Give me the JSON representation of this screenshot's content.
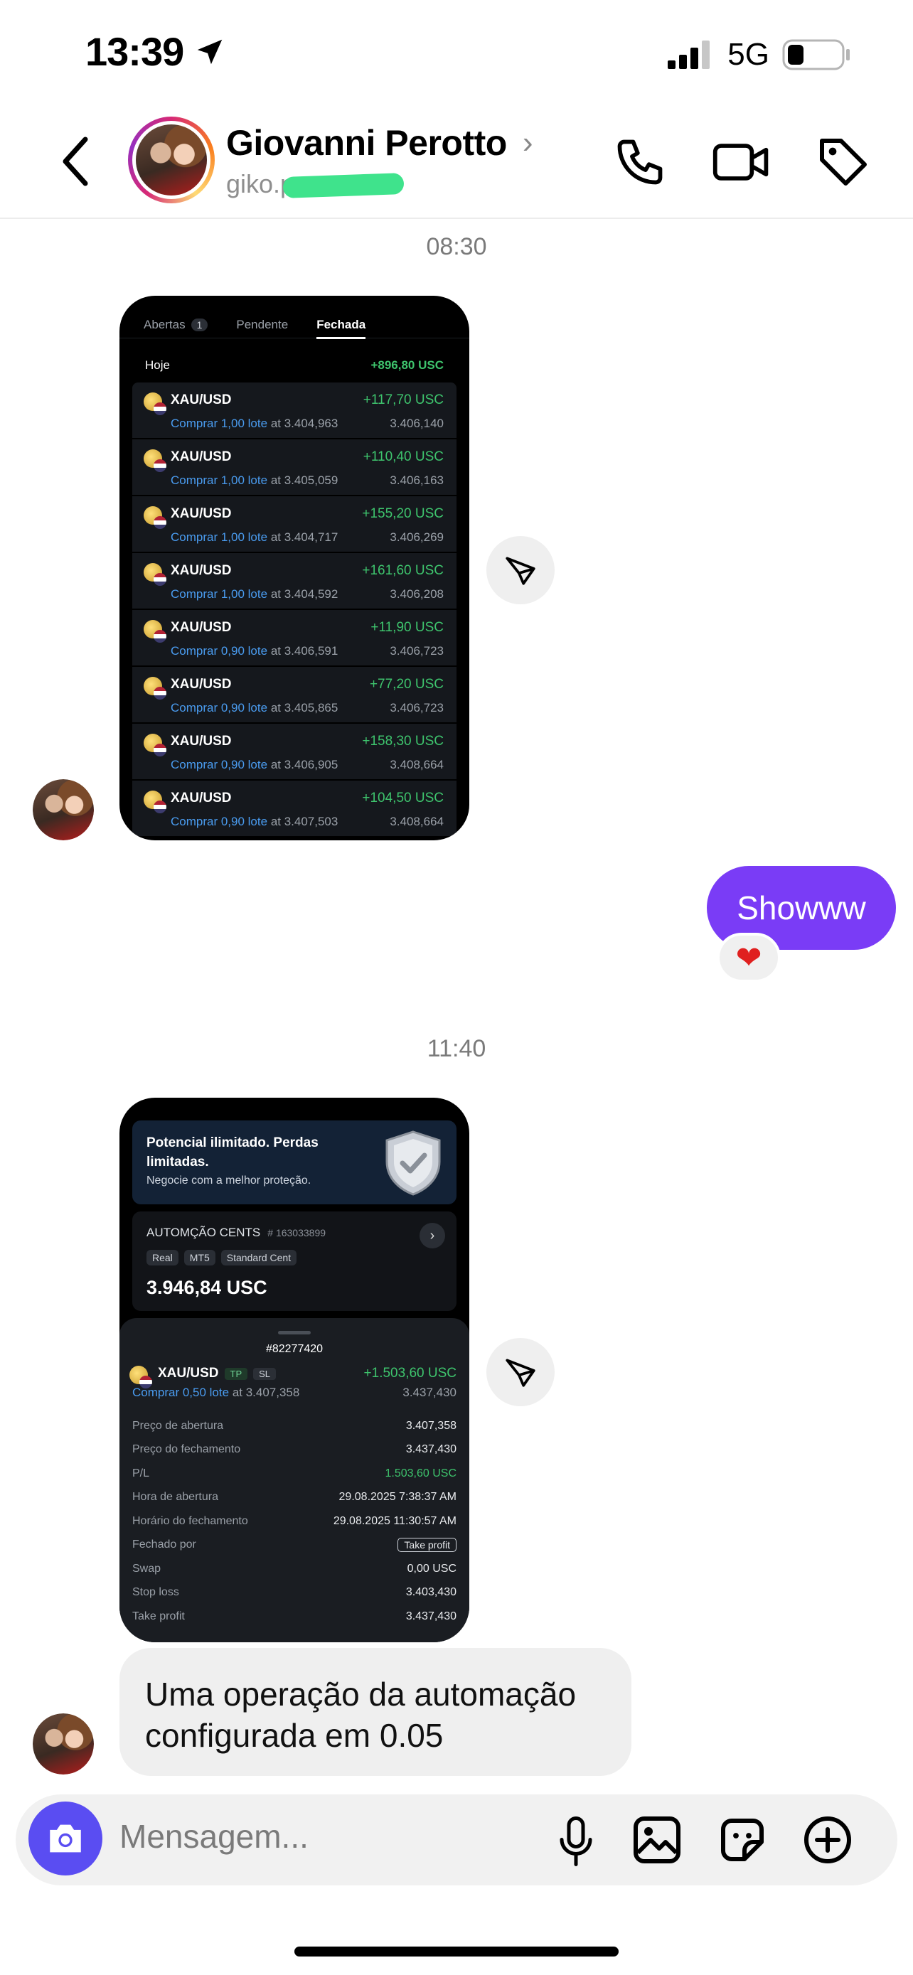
{
  "status_bar": {
    "time": "13:39",
    "network": "5G"
  },
  "header": {
    "name": "Giovanni Perotto",
    "handle": "giko.perotto"
  },
  "messages": {
    "time1": "08:30",
    "time2": "11:40",
    "me_text": "Showww",
    "reaction": "❤",
    "them_text": "Uma operação da automação configurada em 0.05"
  },
  "shot1": {
    "tabs": [
      {
        "label": "Abertas",
        "badge": "1"
      },
      {
        "label": "Pendente"
      },
      {
        "label": "Fechada"
      }
    ],
    "day_label": "Hoje",
    "day_total": "+896,80 USC",
    "trades": [
      {
        "symbol": "XAU/USD",
        "action": "Comprar 1,00 lote",
        "at": "at 3.404,963",
        "pnl": "+117,70 USC",
        "close": "3.406,140"
      },
      {
        "symbol": "XAU/USD",
        "action": "Comprar 1,00 lote",
        "at": "at 3.405,059",
        "pnl": "+110,40 USC",
        "close": "3.406,163"
      },
      {
        "symbol": "XAU/USD",
        "action": "Comprar 1,00 lote",
        "at": "at 3.404,717",
        "pnl": "+155,20 USC",
        "close": "3.406,269"
      },
      {
        "symbol": "XAU/USD",
        "action": "Comprar 1,00 lote",
        "at": "at 3.404,592",
        "pnl": "+161,60 USC",
        "close": "3.406,208"
      },
      {
        "symbol": "XAU/USD",
        "action": "Comprar 0,90 lote",
        "at": "at 3.406,591",
        "pnl": "+11,90 USC",
        "close": "3.406,723"
      },
      {
        "symbol": "XAU/USD",
        "action": "Comprar 0,90 lote",
        "at": "at 3.405,865",
        "pnl": "+77,20 USC",
        "close": "3.406,723"
      },
      {
        "symbol": "XAU/USD",
        "action": "Comprar 0,90 lote",
        "at": "at 3.406,905",
        "pnl": "+158,30 USC",
        "close": "3.408,664"
      },
      {
        "symbol": "XAU/USD",
        "action": "Comprar 0,90 lote",
        "at": "at 3.407,503",
        "pnl": "+104,50 USC",
        "close": "3.408,664"
      }
    ]
  },
  "shot2": {
    "promo_title": "Potencial ilimitado. Perdas limitadas.",
    "promo_sub": "Negocie com a melhor proteção.",
    "account_name": "AUTOMÇÃO CENTS",
    "account_id": "# 163033899",
    "chips": [
      "Real",
      "MT5",
      "Standard Cent"
    ],
    "balance": "3.946,84 USC",
    "ticket": "#82277420",
    "symbol": "XAU/USD",
    "tags": [
      "TP",
      "SL"
    ],
    "pnl": "+1.503,60 USC",
    "action": "Comprar 0,50 lote",
    "at": "at 3.407,358",
    "close_price": "3.437,430",
    "details": [
      {
        "label": "Preço de abertura",
        "value": "3.407,358"
      },
      {
        "label": "Preço do fechamento",
        "value": "3.437,430"
      },
      {
        "label": "P/L",
        "value": "1.503,60 USC"
      },
      {
        "label": "Hora de abertura",
        "value": "29.08.2025 7:38:37 AM"
      },
      {
        "label": "Horário do fechamento",
        "value": "29.08.2025 11:30:57 AM"
      },
      {
        "label": "Fechado por",
        "value": "Take profit"
      },
      {
        "label": "Swap",
        "value": "0,00 USC"
      },
      {
        "label": "Stop loss",
        "value": "3.403,430"
      },
      {
        "label": "Take profit",
        "value": "3.437,430"
      }
    ]
  },
  "composer": {
    "placeholder": "Mensagem..."
  },
  "colors": {
    "accent": "#7a3cf6",
    "camera": "#5a4df2",
    "profit": "#3ec46d",
    "link": "#4a9cf0"
  }
}
